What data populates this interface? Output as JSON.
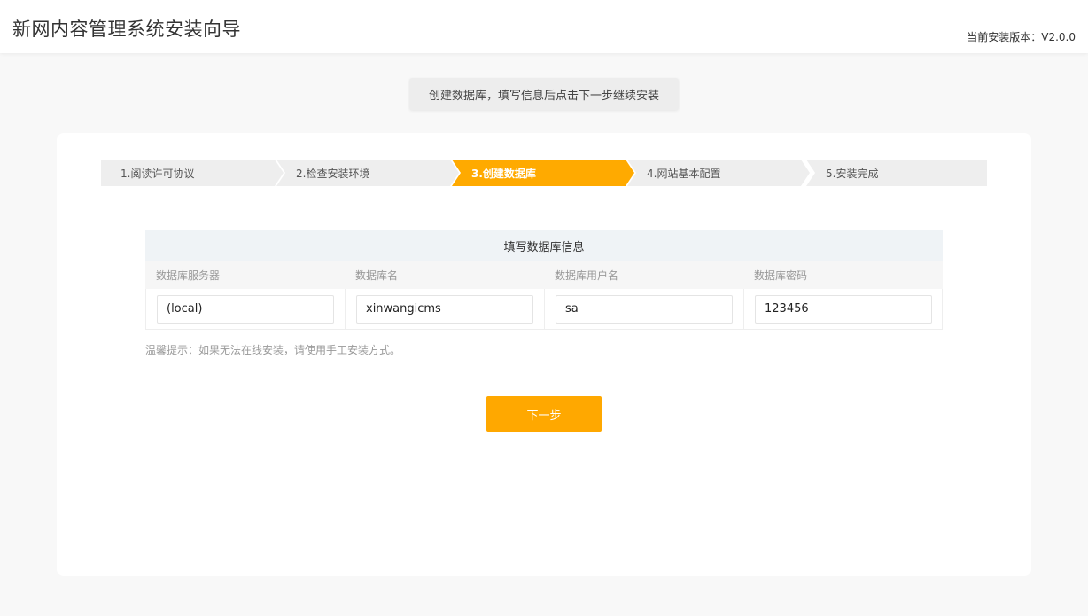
{
  "header": {
    "title": "新网内容管理系统安装向导",
    "version_label": "当前安装版本：V2.0.0"
  },
  "tip_banner": "创建数据库，填写信息后点击下一步继续安装",
  "steps": [
    {
      "label": "1.阅读许可协议",
      "active": false
    },
    {
      "label": "2.检查安装环境",
      "active": false
    },
    {
      "label": "3.创建数据库",
      "active": true
    },
    {
      "label": "4.网站基本配置",
      "active": false
    },
    {
      "label": "5.安装完成",
      "active": false
    }
  ],
  "db_form": {
    "title": "填写数据库信息",
    "columns": [
      "数据库服务器",
      "数据库名",
      "数据库用户名",
      "数据库密码"
    ],
    "values": [
      "(local)",
      "xinwangicms",
      "sa",
      "123456"
    ]
  },
  "warm_tip": "温馨提示：如果无法在线安装，请使用手工安装方式。",
  "next_button": "下一步",
  "colors": {
    "accent": "#ffaa00",
    "button": "#ffa800",
    "step_inactive": "#eeeeee",
    "form_title_bg": "#eff3f6"
  }
}
